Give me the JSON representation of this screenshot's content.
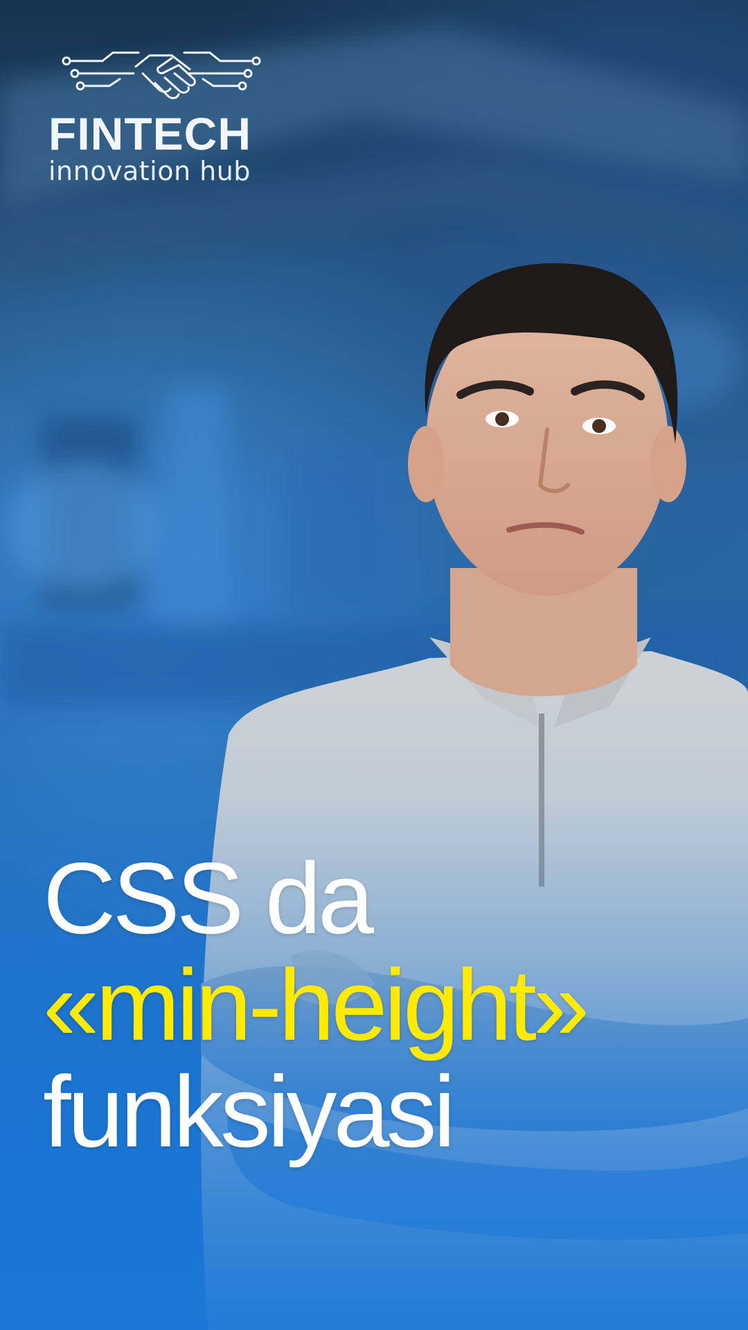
{
  "logo": {
    "icon": "handshake-circuit-icon",
    "wordmark": "FINTECH",
    "tagline": "innovation hub"
  },
  "headline": {
    "line1": "CSS da",
    "line2": "«min-height»",
    "line3": "funksiyasi"
  },
  "colors": {
    "background_blue": "#1a77d6",
    "accent_yellow": "#ffea00",
    "text_white": "#ffffff",
    "shirt_gray": "#c7cdd2"
  }
}
